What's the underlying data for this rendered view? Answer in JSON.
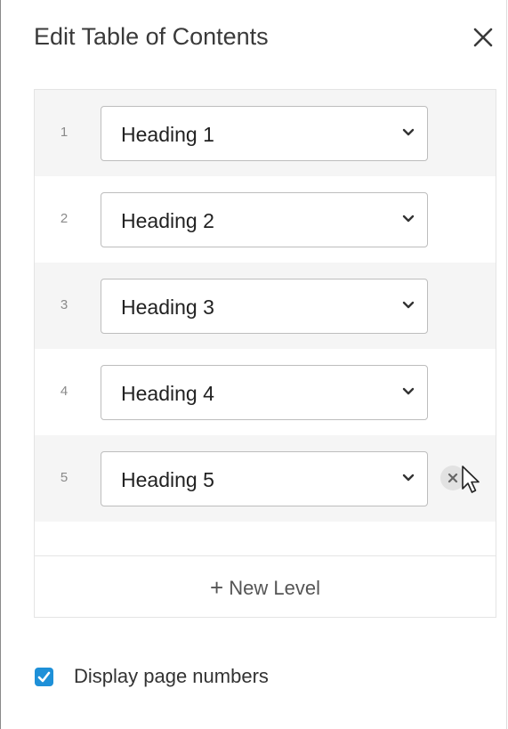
{
  "dialog": {
    "title": "Edit Table of Contents",
    "close_icon": "close-icon"
  },
  "levels": [
    {
      "number": "1",
      "value": "Heading 1"
    },
    {
      "number": "2",
      "value": "Heading 2"
    },
    {
      "number": "3",
      "value": "Heading 3"
    },
    {
      "number": "4",
      "value": "Heading 4"
    },
    {
      "number": "5",
      "value": "Heading 5",
      "removable": true
    }
  ],
  "new_level": {
    "icon": "plus-icon",
    "label": "New Level"
  },
  "options": {
    "display_page_numbers_label": "Display page numbers",
    "display_page_numbers_checked": true
  },
  "colors": {
    "accent": "#1e90d8",
    "row_shade": "#f5f5f5"
  }
}
